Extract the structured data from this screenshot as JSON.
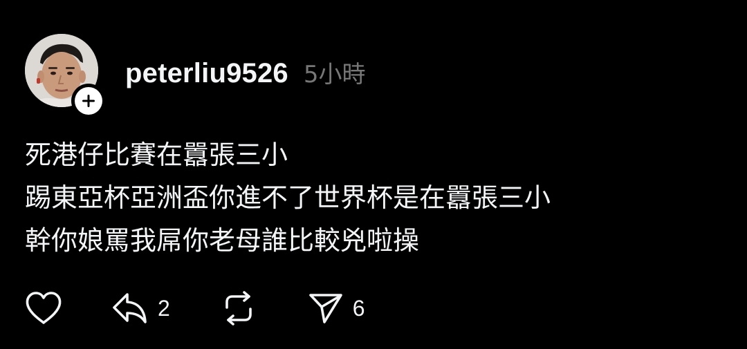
{
  "post": {
    "author": {
      "username": "peterliu9526",
      "avatar_alt": "avatar",
      "follow_icon": "plus-icon"
    },
    "timestamp": "5小時",
    "body_lines": [
      "死港仔比賽在囂張三小",
      "踢東亞杯亞洲盃你進不了世界杯是在囂張三小",
      "幹你娘罵我屌你老母誰比較兇啦操"
    ],
    "actions": {
      "like": {
        "icon": "heart-icon",
        "count": ""
      },
      "reply": {
        "icon": "reply-icon",
        "count": "2"
      },
      "repost": {
        "icon": "repost-icon",
        "count": ""
      },
      "share": {
        "icon": "send-icon",
        "count": "6"
      }
    }
  },
  "colors": {
    "background": "#000000",
    "text_primary": "#f3f5f7",
    "text_secondary": "#777777"
  }
}
